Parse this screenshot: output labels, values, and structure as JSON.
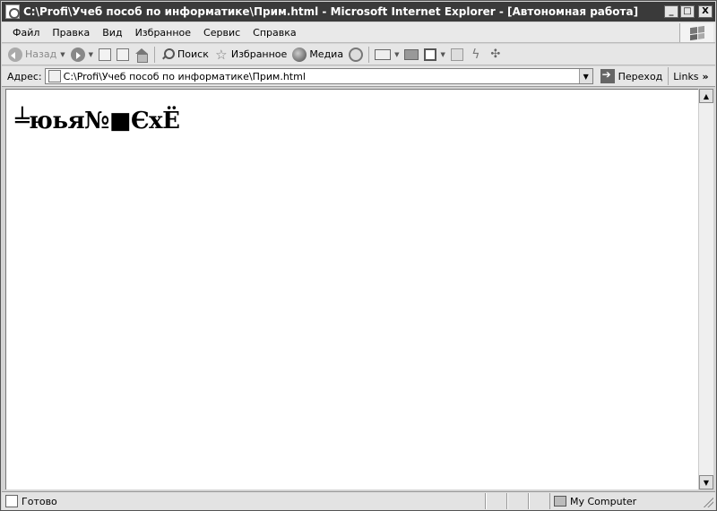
{
  "window": {
    "title": "C:\\Profi\\Учеб пособ по информатике\\Прим.html - Microsoft Internet Explorer - [Автономная работа]",
    "buttons": {
      "minimize": "_",
      "maximize": "□",
      "close": "X"
    }
  },
  "menu": {
    "items": [
      "Файл",
      "Правка",
      "Вид",
      "Избранное",
      "Сервис",
      "Справка"
    ]
  },
  "toolbar": {
    "back_label": "Назад",
    "search_label": "Поиск",
    "favorites_label": "Избранное",
    "media_label": "Медиа"
  },
  "address": {
    "label": "Адрес:",
    "value": "C:\\Profi\\Учеб пособ по информатике\\Прим.html",
    "go_label": "Переход",
    "links_label": "Links",
    "links_chevron": "»"
  },
  "content": {
    "text": "╧юья№■ЄхЁ"
  },
  "status": {
    "text": "Готово",
    "zone": "My Computer"
  }
}
